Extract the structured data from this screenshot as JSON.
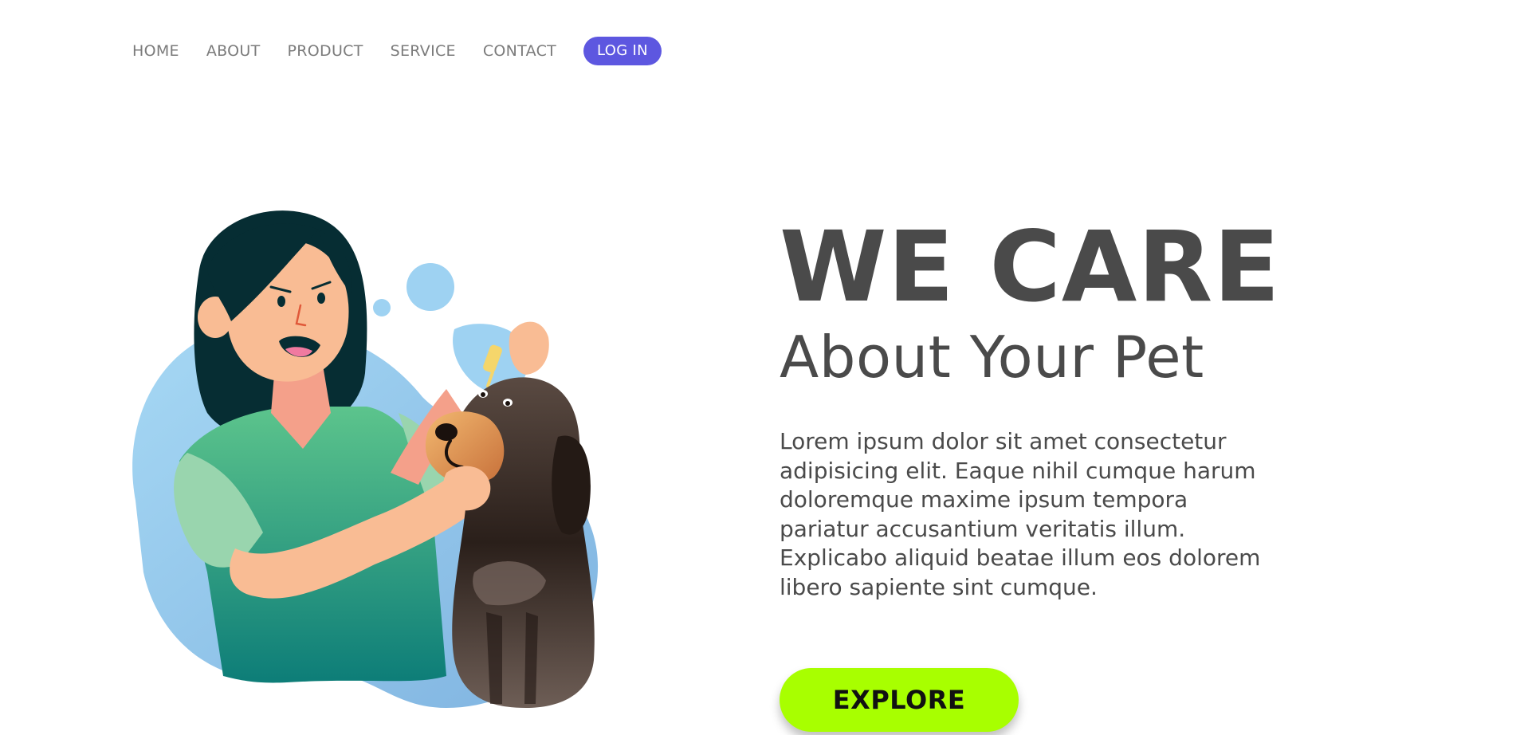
{
  "nav": {
    "items": [
      {
        "label": "HOME"
      },
      {
        "label": "ABOUT"
      },
      {
        "label": "PRODUCT"
      },
      {
        "label": "SERVICE"
      },
      {
        "label": "CONTACT"
      }
    ],
    "login_label": "LOG IN"
  },
  "hero": {
    "headline": "WE CARE",
    "subheadline": "About Your Pet",
    "body": "Lorem ipsum dolor sit amet consectetur adipisicing elit. Eaque nihil cumque harum doloremque maxime ipsum tempora pariatur accusantium veritatis illum. Explicabo aliquid beatae illum eos dolorem libero sapiente sint cumque.",
    "cta_label": "EXPLORE"
  },
  "colors": {
    "accent": "#5d57e0",
    "cta": "#a8ff00",
    "text": "#4a4a4a",
    "nav_text": "#7b7b7b"
  },
  "illustration": {
    "icon": "woman-giving-dog-eye-drops-illustration"
  }
}
